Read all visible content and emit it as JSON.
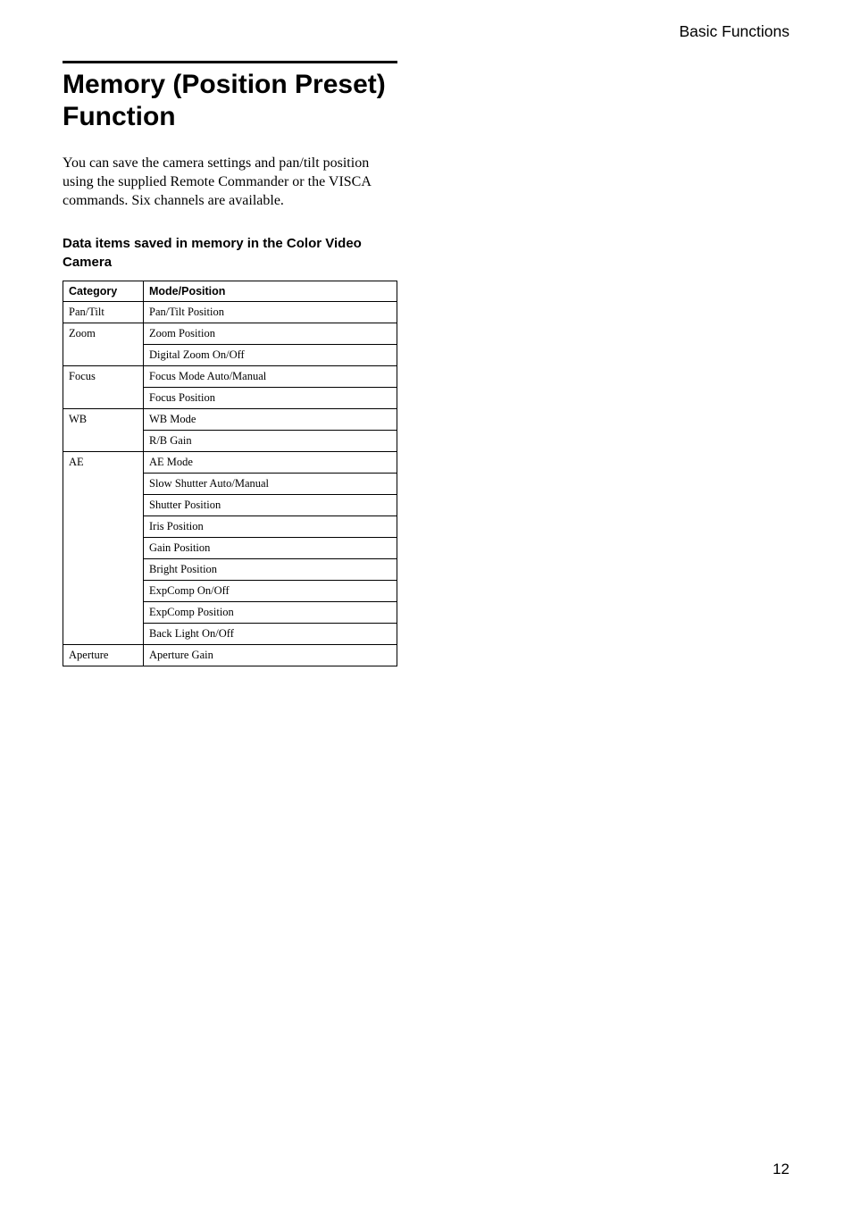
{
  "header": {
    "section_label": "Basic Functions"
  },
  "title": "Memory (Position Preset) Function",
  "intro": "You can save the camera settings and pan/tilt position using the supplied Remote Commander or the VISCA commands. Six channels are available.",
  "subhead": "Data items saved in memory in the Color Video Camera",
  "table": {
    "headers": {
      "col1": "Category",
      "col2": "Mode/Position"
    },
    "rows": [
      {
        "category": "Pan/Tilt",
        "items": [
          "Pan/Tilt Position"
        ]
      },
      {
        "category": "Zoom",
        "items": [
          "Zoom Position",
          "Digital Zoom On/Off"
        ]
      },
      {
        "category": "Focus",
        "items": [
          "Focus Mode Auto/Manual",
          "Focus Position"
        ]
      },
      {
        "category": "WB",
        "items": [
          "WB Mode",
          "R/B Gain"
        ]
      },
      {
        "category": "AE",
        "items": [
          "AE Mode",
          "Slow Shutter Auto/Manual",
          "Shutter Position",
          "Iris Position",
          "Gain Position",
          "Bright Position",
          "ExpComp On/Off",
          "ExpComp Position",
          "Back Light On/Off"
        ]
      },
      {
        "category": "Aperture",
        "items": [
          "Aperture Gain"
        ]
      }
    ]
  },
  "page_number": "12"
}
